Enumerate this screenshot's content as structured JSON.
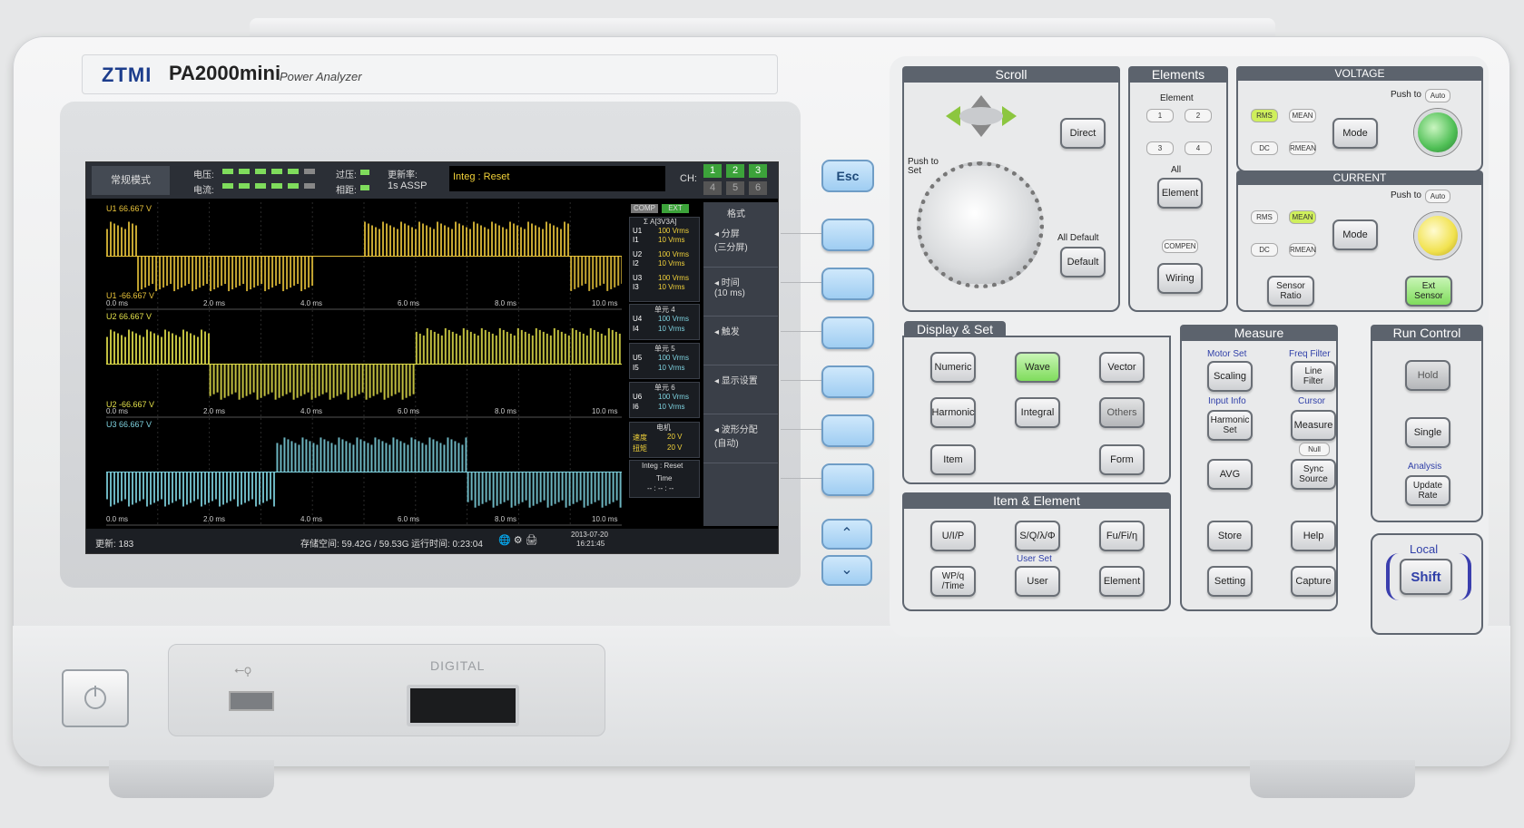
{
  "brand": {
    "logo": "ZTMI",
    "model": "PA2000mini",
    "subtitle": "Power Analyzer"
  },
  "screen": {
    "mode": "常规模式",
    "voltage_label": "电压:",
    "current_label": "电流:",
    "over_label": "过压:",
    "phase_label": "相距:",
    "update_rate_label": "更新率:",
    "update_rate_value": "1s ASSP",
    "integ_status": "Integ : Reset",
    "ch_label": "CH:",
    "ch_buttons": [
      "1",
      "2",
      "3",
      "4",
      "5",
      "6"
    ],
    "comp_label": "COMP",
    "ext_label": "EXT",
    "menu_title": "格式",
    "menu_items": [
      "分屏\n(三分屏)",
      "时间\n(10 ms)",
      "触发",
      "显示设置",
      "波形分配\n(自动)"
    ],
    "channels": [
      {
        "top_label": "U1   66.667 V",
        "bottom_label": "U1  -66.667 V"
      },
      {
        "top_label": "U2   66.667 V",
        "bottom_label": "U2  -66.667 V"
      },
      {
        "top_label": "U3   66.667 V",
        "bottom_label": ""
      }
    ],
    "time_ticks": [
      "0.0 ms",
      "2.0 ms",
      "4.0 ms",
      "6.0 ms",
      "8.0 ms",
      "10.0 ms"
    ],
    "sum_label": "Σ A[3V3A]",
    "element_rows": [
      {
        "u": "U1",
        "u_val": "100 Vrms",
        "i": "I1",
        "i_val": "10 Vrms"
      },
      {
        "u": "U2",
        "u_val": "100 Vrms",
        "i": "I2",
        "i_val": "10 Vrms"
      },
      {
        "u": "U3",
        "u_val": "100 Vrms",
        "i": "I3",
        "i_val": "10 Vrms"
      }
    ],
    "element_groups": [
      {
        "title": "单元 4",
        "u": "U4",
        "u_val": "100 Vrms",
        "i": "I4",
        "i_val": "10 Vrms"
      },
      {
        "title": "单元 5",
        "u": "U5",
        "u_val": "100 Vrms",
        "i": "I5",
        "i_val": "10 Vrms"
      },
      {
        "title": "单元 6",
        "u": "U6",
        "u_val": "100 Vrms",
        "i": "I6",
        "i_val": "10 Vrms"
      }
    ],
    "motor_title": "电机",
    "motor_speed_label": "速度",
    "motor_speed_val": "20 V",
    "motor_torque_label": "扭矩",
    "motor_torque_val": "20 V",
    "integ_box_title": "Integ : Reset",
    "integ_box_time_label": "Time",
    "integ_box_time_val": "-- : -- : --",
    "status_update": "更新: 183",
    "status_storage": "存储空间: 59.42G / 59.53G",
    "status_runtime": "运行时间: 0:23:04",
    "status_date": "2013-07-20",
    "status_time": "16:21:45"
  },
  "softkeys": {
    "esc": "Esc",
    "up": "⌃",
    "down": "⌄"
  },
  "scroll": {
    "title": "Scroll",
    "push_to_set": "Push to\nSet",
    "direct": "Direct",
    "all_default": "All Default",
    "default": "Default"
  },
  "elements": {
    "title": "Elements",
    "element_label": "Element",
    "pills": [
      "1",
      "2",
      "3",
      "4"
    ],
    "all_label": "All",
    "element_btn": "Element",
    "compen": "COMPEN",
    "wiring": "Wiring"
  },
  "voltage": {
    "title": "VOLTAGE",
    "push_to": "Push to",
    "auto": "Auto",
    "rms": "RMS",
    "mean": "MEAN",
    "dc": "DC",
    "rmean": "RMEAN",
    "mode": "Mode"
  },
  "current": {
    "title": "CURRENT",
    "push_to": "Push to",
    "auto": "Auto",
    "rms": "RMS",
    "mean": "MEAN",
    "dc": "DC",
    "rmean": "RMEAN",
    "mode": "Mode",
    "sensor_ratio": "Sensor\nRatio",
    "ext_sensor": "Ext\nSensor"
  },
  "display_set": {
    "title": "Display & Set",
    "numeric": "Numeric",
    "wave": "Wave",
    "vector": "Vector",
    "harmonic": "Harmonic",
    "integral": "Integral",
    "others": "Others",
    "item": "Item",
    "form": "Form"
  },
  "item_element": {
    "title": "Item & Element",
    "uip": "U/I/P",
    "sq": "S/Q/λ/Φ",
    "fu": "Fu/Fi/η",
    "wp": "WP/q\n/Time",
    "user_set": "User Set",
    "user": "User",
    "element": "Element"
  },
  "measure": {
    "title": "Measure",
    "motor_set": "Motor Set",
    "scaling": "Scaling",
    "freq_filter": "Freq Filter",
    "line_filter": "Line\nFilter",
    "input_info": "Input Info",
    "harmonic_set": "Harmonic\nSet",
    "cursor": "Cursor",
    "measure": "Measure",
    "null": "Null",
    "avg": "AVG",
    "sync_source": "Sync\nSource",
    "store": "Store",
    "help": "Help",
    "setting": "Setting",
    "capture": "Capture"
  },
  "run_control": {
    "title": "Run Control",
    "hold": "Hold",
    "single": "Single",
    "analysis": "Analysis",
    "update_rate": "Update\nRate"
  },
  "local": {
    "label": "Local",
    "shift": "Shift"
  },
  "front": {
    "digital": "DIGITAL"
  },
  "colors": {
    "wave_u1": "#e8c33a",
    "wave_u2": "#e3e04a",
    "wave_u3": "#7fd3e0",
    "lit_green": "#7fdc5c",
    "accent_blue": "#2f3fa8"
  }
}
